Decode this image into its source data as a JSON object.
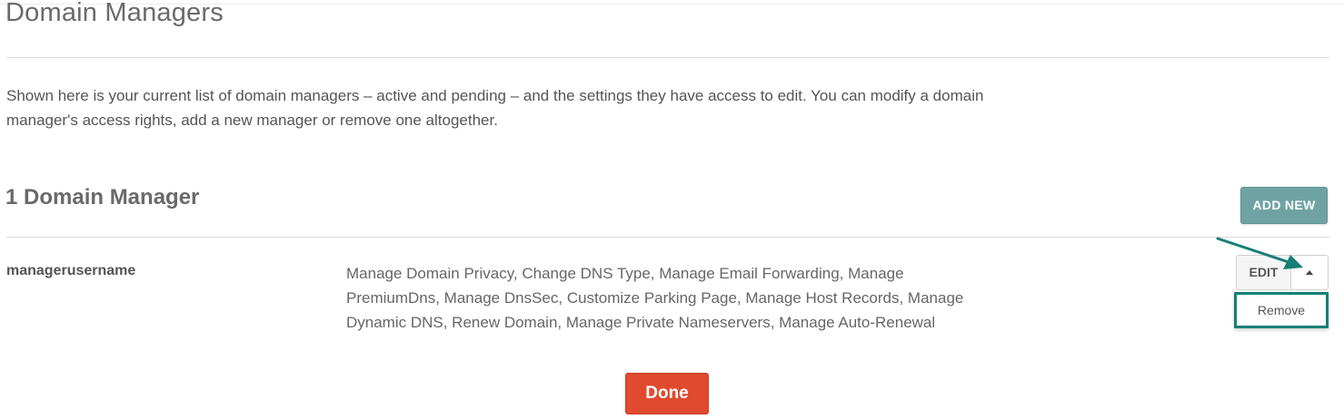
{
  "header": {
    "title": "Domain Managers"
  },
  "intro": {
    "text": "Shown here is your current list of domain managers – active and pending – and the settings they have access to edit. You can modify a domain manager's access rights, add a new manager or remove one altogether."
  },
  "managers_section": {
    "title": "1 Domain Manager",
    "add_new_label": "ADD NEW"
  },
  "manager": {
    "username": "managerusername",
    "permissions": "Manage Domain Privacy, Change DNS Type, Manage Email Forwarding, Manage PremiumDns, Manage DnsSec, Customize Parking Page, Manage Host Records, Manage Dynamic DNS, Renew Domain, Manage Private Nameservers, Manage Auto-Renewal",
    "edit_label": "EDIT",
    "dropdown_items": [
      "Remove"
    ]
  },
  "footer": {
    "done_label": "Done"
  },
  "colors": {
    "add_new_bg": "#6fa3a3",
    "done_bg": "#e04a2f",
    "annotation": "#167f77"
  },
  "icons": {
    "dropdown_toggle": "caret-up-icon",
    "annotation_arrow": "arrow-icon"
  }
}
